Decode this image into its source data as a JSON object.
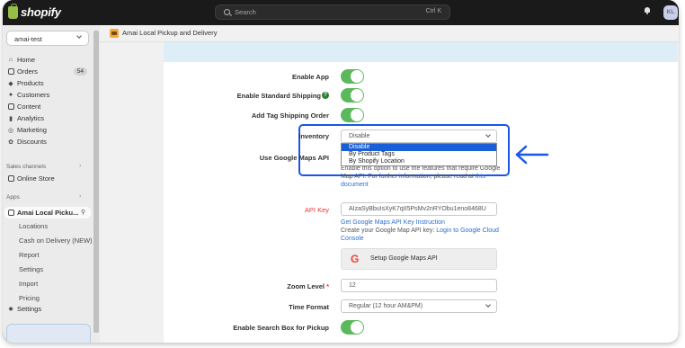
{
  "topbar": {
    "brand": "shopify",
    "search_placeholder": "Search",
    "search_shortcut": "Ctrl K",
    "avatar_initials": "KL"
  },
  "sidebar": {
    "store": "amai-test",
    "nav": [
      {
        "label": "Home",
        "icon": "home-icon"
      },
      {
        "label": "Orders",
        "icon": "orders-icon",
        "badge": "54"
      },
      {
        "label": "Products",
        "icon": "tag-icon"
      },
      {
        "label": "Customers",
        "icon": "person-icon"
      },
      {
        "label": "Content",
        "icon": "content-icon"
      },
      {
        "label": "Analytics",
        "icon": "bar-chart-icon"
      },
      {
        "label": "Marketing",
        "icon": "target-icon"
      },
      {
        "label": "Discounts",
        "icon": "discount-icon"
      }
    ],
    "sales_channels_label": "Sales channels",
    "online_store": "Online Store",
    "apps_label": "Apps",
    "app_name": "Amai Local Picku...",
    "app_subitems": [
      "Locations",
      "Cash on Delivery (NEW)",
      "Report",
      "Settings",
      "Import",
      "Pricing"
    ],
    "settings": "Settings"
  },
  "main": {
    "app_title": "Amai Local Pickup and Delivery",
    "form": {
      "enable_app": "Enable App",
      "enable_standard_shipping": "Enable Standard Shipping",
      "add_tag_shipping_order": "Add Tag Shipping Order",
      "inventory_label": "Inventory",
      "inventory_value": "Disable",
      "inventory_options": [
        "Disable",
        "By Product Tags",
        "By Shopify Location"
      ],
      "use_google_maps_api": "Use Google Maps API",
      "maps_help_1": "Enable this option to use the features that require Google",
      "maps_help_2": "Map API. For further information, please read at ",
      "maps_help_link_1": "this",
      "maps_help_link_2": "document",
      "api_key_label": "API Key",
      "api_key_value": "AIzaSyBbuIsXyK7qII5PsMv2nRYObu1eno8468U",
      "get_api_key_link": "Get Google Maps API Key Instruction",
      "api_help_text": "Create your Google Map API key: ",
      "api_help_link_1": "Login to Google Cloud",
      "api_help_link_2": "Console",
      "setup_button": "Setup Google Maps API",
      "zoom_label": "Zoom Level",
      "zoom_required": "*",
      "zoom_value": "12",
      "time_format_label": "Time Format",
      "time_format_value": "Regular (12 hour AM&PM)",
      "enable_search_box": "Enable Search Box for Pickup"
    }
  },
  "colors": {
    "toggle_on": "#5cb85c",
    "highlight": "#1a56e8",
    "api_key_label": "#e53935",
    "link": "#2b6fd0"
  }
}
